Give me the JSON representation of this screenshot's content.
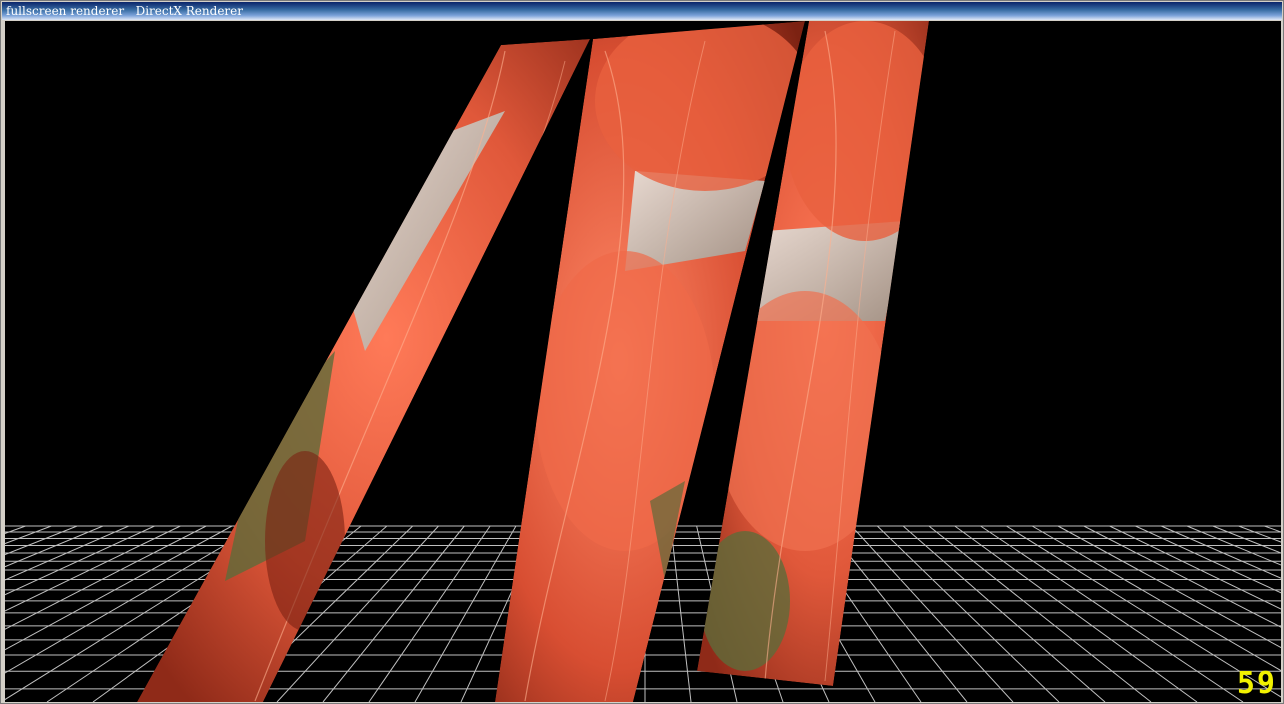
{
  "window": {
    "title": "fullscreen renderer   DirectX Renderer"
  },
  "scene": {
    "background_color": "#000000",
    "grid_color": "#ffffff",
    "panel_primary_color": "#e0583a",
    "panel_secondary_color": "#ff7a58",
    "panel_dark_color": "#8f2a18",
    "panel_count": 3
  },
  "overlay": {
    "fps_value": "59",
    "fps_color": "#f2f200"
  }
}
